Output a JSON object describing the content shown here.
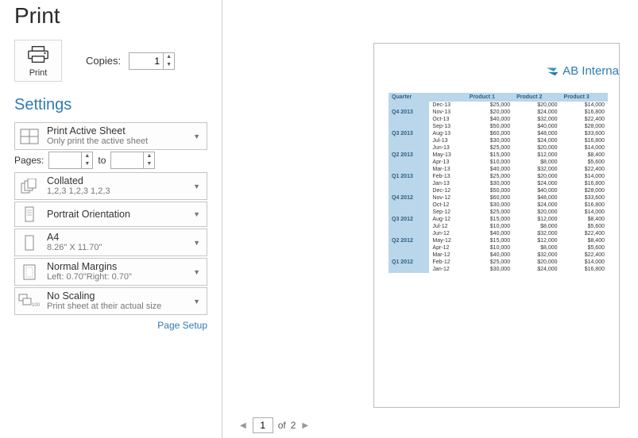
{
  "header": {
    "title": "Print"
  },
  "print_button": {
    "label": "Print"
  },
  "copies": {
    "label": "Copies:",
    "value": "1"
  },
  "settings_header": "Settings",
  "settings": {
    "what": {
      "title": "Print Active Sheet",
      "sub": "Only print the active sheet"
    },
    "pages": {
      "label": "Pages:",
      "from": "",
      "to_label": "to",
      "to": ""
    },
    "collate": {
      "title": "Collated",
      "sub": "1,2,3  1,2,3  1,2,3"
    },
    "orientation": {
      "title": "Portrait Orientation",
      "sub": ""
    },
    "paper": {
      "title": "A4",
      "sub": "8.26\" X 11.70\""
    },
    "margins": {
      "title": "Normal Margins",
      "sub": "Left: 0.70\"Right: 0.70\""
    },
    "scaling": {
      "title": "No Scaling",
      "sub": "Print sheet at their actual size"
    }
  },
  "page_setup_link": "Page Setup",
  "pager": {
    "current": "1",
    "of_label": "of",
    "total": "2"
  },
  "preview": {
    "company": "AB Interna",
    "headers": [
      "Quarter",
      "",
      "Product 1",
      "Product 2",
      "Product 3"
    ],
    "rows": [
      {
        "q": "",
        "m": "Dec-13",
        "p1": "$25,000",
        "p2": "$20,000",
        "p3": "$14,000"
      },
      {
        "q": "Q4 2013",
        "m": "Nov-13",
        "p1": "$20,000",
        "p2": "$24,000",
        "p3": "$16,800"
      },
      {
        "q": "",
        "m": "Oct-13",
        "p1": "$40,000",
        "p2": "$32,000",
        "p3": "$22,400"
      },
      {
        "q": "",
        "m": "Sep-13",
        "p1": "$50,000",
        "p2": "$40,000",
        "p3": "$28,000"
      },
      {
        "q": "Q3 2013",
        "m": "Aug-13",
        "p1": "$60,000",
        "p2": "$48,000",
        "p3": "$33,600"
      },
      {
        "q": "",
        "m": "Jul-13",
        "p1": "$30,000",
        "p2": "$24,000",
        "p3": "$16,800"
      },
      {
        "q": "",
        "m": "Jun-13",
        "p1": "$25,000",
        "p2": "$20,000",
        "p3": "$14,000"
      },
      {
        "q": "Q2 2013",
        "m": "May-13",
        "p1": "$15,000",
        "p2": "$12,000",
        "p3": "$8,400"
      },
      {
        "q": "",
        "m": "Apr-13",
        "p1": "$10,000",
        "p2": "$8,000",
        "p3": "$5,600"
      },
      {
        "q": "",
        "m": "Mar-13",
        "p1": "$40,000",
        "p2": "$32,000",
        "p3": "$22,400"
      },
      {
        "q": "Q1 2013",
        "m": "Feb-13",
        "p1": "$25,000",
        "p2": "$20,000",
        "p3": "$14,000"
      },
      {
        "q": "",
        "m": "Jan-13",
        "p1": "$30,000",
        "p2": "$24,000",
        "p3": "$16,800"
      },
      {
        "q": "",
        "m": "Dec-12",
        "p1": "$50,000",
        "p2": "$40,000",
        "p3": "$28,000"
      },
      {
        "q": "Q4 2012",
        "m": "Nov-12",
        "p1": "$60,000",
        "p2": "$48,000",
        "p3": "$33,600"
      },
      {
        "q": "",
        "m": "Oct-12",
        "p1": "$30,000",
        "p2": "$24,000",
        "p3": "$16,800"
      },
      {
        "q": "",
        "m": "Sep-12",
        "p1": "$25,000",
        "p2": "$20,000",
        "p3": "$14,000"
      },
      {
        "q": "Q3 2012",
        "m": "Aug-12",
        "p1": "$15,000",
        "p2": "$12,000",
        "p3": "$8,400"
      },
      {
        "q": "",
        "m": "Jul-12",
        "p1": "$10,000",
        "p2": "$8,000",
        "p3": "$5,600"
      },
      {
        "q": "",
        "m": "Jun-12",
        "p1": "$40,000",
        "p2": "$32,000",
        "p3": "$22,400"
      },
      {
        "q": "Q2 2012",
        "m": "May-12",
        "p1": "$15,000",
        "p2": "$12,000",
        "p3": "$8,400"
      },
      {
        "q": "",
        "m": "Apr-12",
        "p1": "$10,000",
        "p2": "$8,000",
        "p3": "$5,600"
      },
      {
        "q": "",
        "m": "Mar-12",
        "p1": "$40,000",
        "p2": "$32,000",
        "p3": "$22,400"
      },
      {
        "q": "Q1 2012",
        "m": "Feb-12",
        "p1": "$25,000",
        "p2": "$20,000",
        "p3": "$14,000"
      },
      {
        "q": "",
        "m": "Jan-12",
        "p1": "$30,000",
        "p2": "$24,000",
        "p3": "$16,800"
      }
    ]
  }
}
